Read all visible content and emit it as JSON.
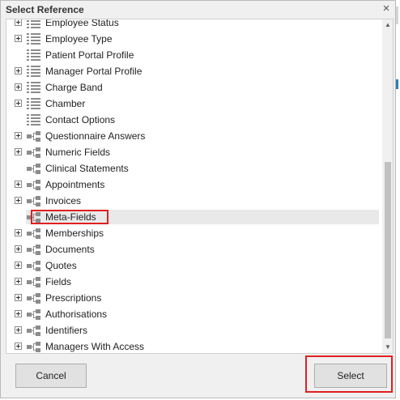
{
  "dialog": {
    "title": "Select Reference",
    "close_glyph": "×"
  },
  "tree": {
    "items": [
      {
        "label": "Employee Status",
        "icon": "list-icon",
        "expandable": true
      },
      {
        "label": "Employee Type",
        "icon": "list-icon",
        "expandable": true
      },
      {
        "label": "Patient Portal Profile",
        "icon": "list-icon",
        "expandable": false
      },
      {
        "label": "Manager Portal Profile",
        "icon": "list-icon",
        "expandable": true
      },
      {
        "label": "Charge Band",
        "icon": "list-icon",
        "expandable": true
      },
      {
        "label": "Chamber",
        "icon": "list-icon",
        "expandable": true
      },
      {
        "label": "Contact Options",
        "icon": "list-icon",
        "expandable": false
      },
      {
        "label": "Questionnaire Answers",
        "icon": "hierarchy-icon",
        "expandable": true
      },
      {
        "label": "Numeric Fields",
        "icon": "hierarchy-icon",
        "expandable": true
      },
      {
        "label": "Clinical Statements",
        "icon": "hierarchy-icon",
        "expandable": false
      },
      {
        "label": "Appointments",
        "icon": "hierarchy-icon",
        "expandable": true
      },
      {
        "label": "Invoices",
        "icon": "hierarchy-icon",
        "expandable": true
      },
      {
        "label": "Meta-Fields",
        "icon": "hierarchy-icon",
        "expandable": false,
        "selected": true
      },
      {
        "label": "Memberships",
        "icon": "hierarchy-icon",
        "expandable": true
      },
      {
        "label": "Documents",
        "icon": "hierarchy-icon",
        "expandable": true
      },
      {
        "label": "Quotes",
        "icon": "hierarchy-icon",
        "expandable": true
      },
      {
        "label": "Fields",
        "icon": "hierarchy-icon",
        "expandable": true
      },
      {
        "label": "Prescriptions",
        "icon": "hierarchy-icon",
        "expandable": true
      },
      {
        "label": "Authorisations",
        "icon": "hierarchy-icon",
        "expandable": true
      },
      {
        "label": "Identifiers",
        "icon": "hierarchy-icon",
        "expandable": true
      },
      {
        "label": "Managers With Access",
        "icon": "hierarchy-icon",
        "expandable": true
      }
    ]
  },
  "buttons": {
    "cancel": "Cancel",
    "select": "Select"
  },
  "colors": {
    "highlight": "#e02020",
    "selected_row": "#e9e9e9"
  }
}
